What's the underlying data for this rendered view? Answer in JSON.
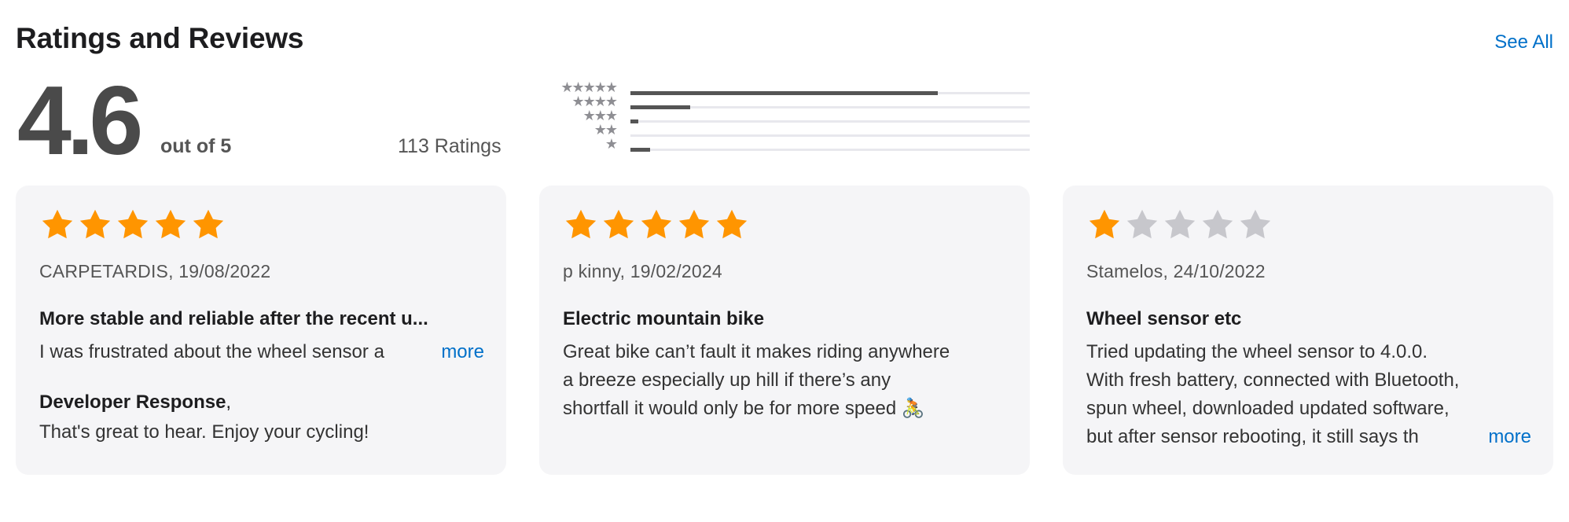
{
  "header": {
    "title": "Ratings and Reviews",
    "see_all": "See All"
  },
  "summary": {
    "score": "4.6",
    "out_of": "out of 5",
    "count": "113 Ratings",
    "distribution": [
      {
        "stars": 5,
        "label": "★★★★★",
        "fraction": 0.77
      },
      {
        "stars": 4,
        "label": "★★★★",
        "fraction": 0.15
      },
      {
        "stars": 3,
        "label": "★★★",
        "fraction": 0.02
      },
      {
        "stars": 2,
        "label": "★★",
        "fraction": 0.0
      },
      {
        "stars": 1,
        "label": "★",
        "fraction": 0.05
      }
    ]
  },
  "colors": {
    "star_filled": "#ff9500",
    "star_empty": "#c7c7cc",
    "link": "#0070c9",
    "card_bg": "#f5f5f7"
  },
  "reviews": [
    {
      "rating": 5,
      "author_date": "CARPETARDIS, 19/08/2022",
      "title": "More stable and reliable after the recent u...",
      "body_lines": [
        "I was frustrated about the wheel sensor a"
      ],
      "more": "more",
      "developer_response_label": "Developer Response",
      "developer_response": "That's great to hear. Enjoy your cycling!"
    },
    {
      "rating": 5,
      "author_date": "p kinny, 19/02/2024",
      "title": "Electric mountain bike",
      "body_lines": [
        "Great bike can’t fault it makes riding anywhere",
        "a breeze especially up hill if there’s any",
        "shortfall it would only be for more speed 🚴"
      ]
    },
    {
      "rating": 1,
      "author_date": "Stamelos, 24/10/2022",
      "title": "Wheel sensor etc",
      "body_lines": [
        "Tried updating the wheel sensor to 4.0.0.",
        "With fresh battery, connected with Bluetooth,",
        "spun wheel, downloaded updated software,",
        "but after sensor rebooting, it still says th"
      ],
      "more": "more"
    }
  ]
}
